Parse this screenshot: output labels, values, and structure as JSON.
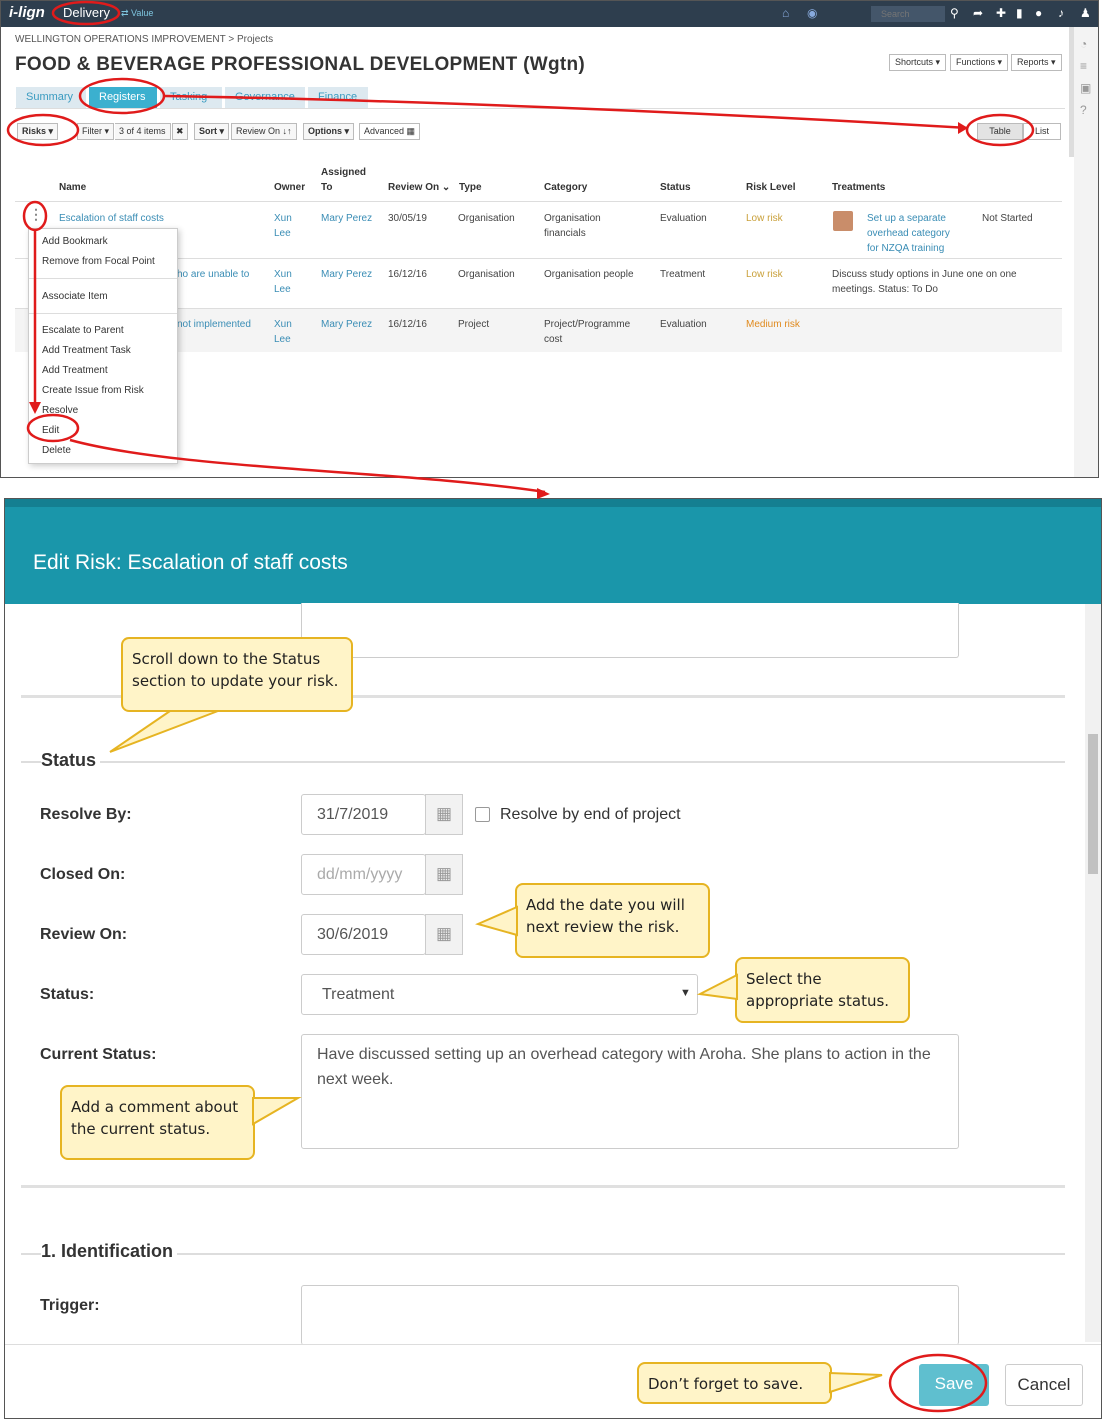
{
  "topbar": {
    "logo": "i-lign",
    "mode": "Delivery",
    "switch": "⇄ Value",
    "search_placeholder": "Search"
  },
  "breadcrumb": "WELLINGTON OPERATIONS IMPROVEMENT > Projects",
  "page_title": "FOOD & BEVERAGE PROFESSIONAL DEVELOPMENT (Wgtn)",
  "header_buttons": {
    "shortcuts": "Shortcuts ▾",
    "functions": "Functions ▾",
    "reports": "Reports ▾"
  },
  "tabs": [
    "Summary",
    "Registers",
    "Tasking",
    "Governance",
    "Finance"
  ],
  "toolbar": {
    "risks": "Risks ▾",
    "filter": "Filter ▾",
    "items": "3 of 4 items",
    "clear": "✖",
    "sort": "Sort ▾",
    "review_on": "Review On ↓↑",
    "options": "Options ▾",
    "advanced": "Advanced ▦",
    "table": "Table",
    "list": "List"
  },
  "table": {
    "headers": {
      "name": "Name",
      "owner": "Owner",
      "assigned": "Assigned",
      "assigned2": "To",
      "review": "Review On ⌄",
      "type": "Type",
      "category": "Category",
      "status": "Status",
      "level": "Risk Level",
      "treatments": "Treatments"
    },
    "rows": [
      {
        "name": "Escalation of staff costs",
        "owner1": "Xun",
        "owner2": "Lee",
        "assigned": "Mary Perez",
        "review": "30/05/19",
        "type": "Organisation",
        "cat1": "Organisation",
        "cat2": "financials",
        "status": "Evaluation",
        "level": "Low risk",
        "treat1": "Set up a separate",
        "treat2": "overhead category",
        "treat3": "for NZQA training",
        "treat_status": "Not Started"
      },
      {
        "name": "ho are unable to",
        "owner1": "Xun",
        "owner2": "Lee",
        "assigned": "Mary Perez",
        "review": "16/12/16",
        "type": "Organisation",
        "cat1": "Organisation people",
        "cat2": "",
        "status": "Treatment",
        "level": "Low risk",
        "treat1": "Discuss study options in June one on one",
        "treat2": "meetings. Status: To Do"
      },
      {
        "name": "not implemented",
        "owner1": "Xun",
        "owner2": "Lee",
        "assigned": "Mary Perez",
        "review": "16/12/16",
        "type": "Project",
        "cat1": "Project/Programme",
        "cat2": "cost",
        "status": "Evaluation",
        "level": "Medium risk"
      }
    ]
  },
  "context_menu": [
    "Add Bookmark",
    "Remove from Focal Point",
    "Associate Item",
    "Escalate to Parent",
    "Add Treatment Task",
    "Add Treatment",
    "Create Issue from Risk",
    "Resolve",
    "Edit",
    "Delete"
  ],
  "modal": {
    "title": "Edit Risk: Escalation of staff costs",
    "status_section": "Status",
    "resolve_by_label": "Resolve By:",
    "resolve_by_value": "31/7/2019",
    "resolve_checkbox": "Resolve by end of project",
    "closed_on_label": "Closed On:",
    "closed_on_placeholder": "dd/mm/yyyy",
    "review_on_label": "Review On:",
    "review_on_value": "30/6/2019",
    "status_label": "Status:",
    "status_value": "Treatment",
    "current_status_label": "Current Status:",
    "current_status_value": "Have discussed setting up an overhead category with Aroha.  She plans to action in the next week.",
    "identification_section": "1. Identification",
    "trigger_label": "Trigger:",
    "save": "Save",
    "cancel": "Cancel"
  },
  "callouts": {
    "scroll": "Scroll down to the Status section to update your risk.",
    "review": "Add the date you will next review the risk.",
    "status": "Select the appropriate status.",
    "comment": "Add a comment about the current status.",
    "save": "Don’t forget to save."
  },
  "colors": {
    "accent": "#1a96aa",
    "highlight": "#e01b1b",
    "callout": "#fff4c8"
  }
}
